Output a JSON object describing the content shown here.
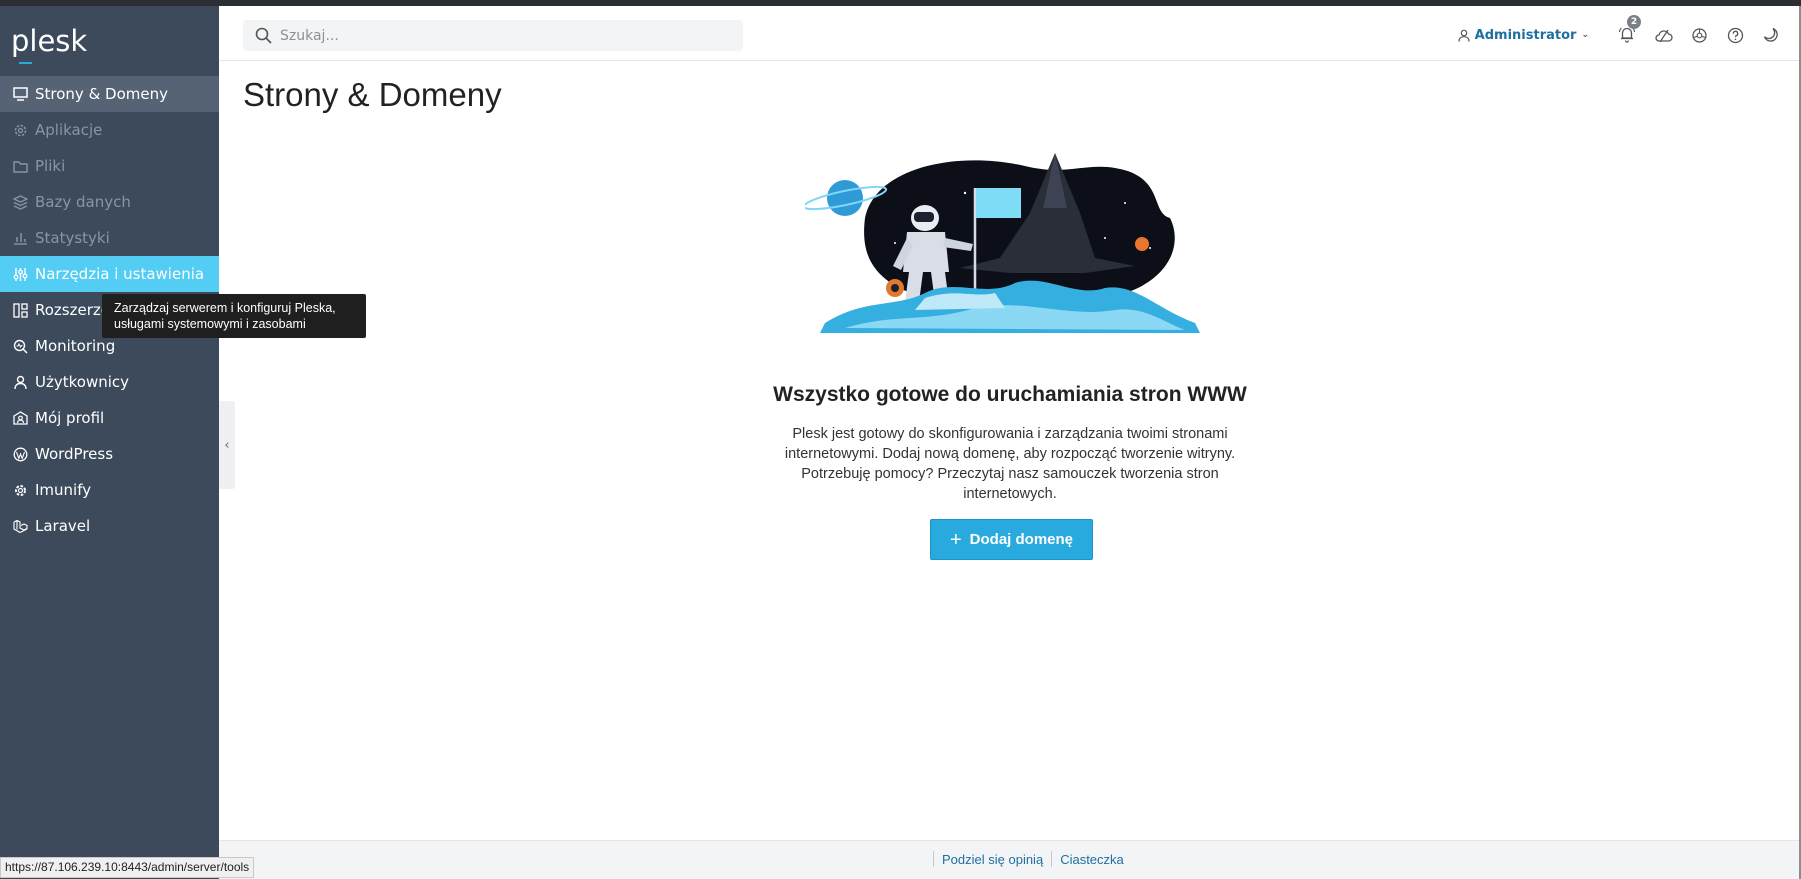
{
  "app": {
    "logo": "plesk"
  },
  "search": {
    "placeholder": "Szukaj..."
  },
  "header": {
    "user": "Administrator",
    "notifications_count": "2",
    "icons": [
      "notifications-icon",
      "cloud-icon",
      "bug-icon",
      "help-icon",
      "dark-mode-icon"
    ]
  },
  "sidebar": {
    "items": [
      {
        "label": "Strony & Domeny",
        "icon": "monitor-icon",
        "state": "active"
      },
      {
        "label": "Aplikacje",
        "icon": "gear-icon",
        "state": "dim"
      },
      {
        "label": "Pliki",
        "icon": "folder-icon",
        "state": "dim"
      },
      {
        "label": "Bazy danych",
        "icon": "database-icon",
        "state": "dim"
      },
      {
        "label": "Statystyki",
        "icon": "chart-icon",
        "state": "dim"
      },
      {
        "label": "Narzędzia i ustawienia",
        "icon": "sliders-icon",
        "state": "highlight"
      },
      {
        "label": "Rozszerzenia",
        "icon": "extensions-icon",
        "state": "normal"
      },
      {
        "label": "Monitoring",
        "icon": "monitoring-icon",
        "state": "normal"
      },
      {
        "label": "Użytkownicy",
        "icon": "user-icon",
        "state": "normal"
      },
      {
        "label": "Mój profil",
        "icon": "profile-icon",
        "state": "normal"
      },
      {
        "label": "WordPress",
        "icon": "wordpress-icon",
        "state": "normal"
      },
      {
        "label": "Imunify",
        "icon": "imunify-icon",
        "state": "normal"
      },
      {
        "label": "Laravel",
        "icon": "laravel-icon",
        "state": "normal"
      }
    ],
    "tooltip": "Zarządzaj serwerem i konfiguruj Pleska, usługami systemowymi i zasobami"
  },
  "main": {
    "title": "Strony & Domeny",
    "empty_title": "Wszystko gotowe do uruchamiania stron WWW",
    "empty_text": "Plesk jest gotowy do skonfigurowania i zarządzania twoimi stronami internetowymi. Dodaj nową domenę, aby rozpocząć tworzenie witryny. Potrzebuję pomocy? Przeczytaj nasz samouczek tworzenia stron internetowych.",
    "add_domain_label": "Dodaj domenę"
  },
  "footer": {
    "feedback": "Podziel się opinią",
    "cookies": "Ciasteczka"
  },
  "statusbar": {
    "url": "https://87.106.239.10:8443/admin/server/tools"
  },
  "colors": {
    "sidebar": "#3c4a5c",
    "active": "#556375",
    "highlight": "#53cdf3",
    "accent": "#28aade",
    "link": "#1f6fa0"
  }
}
